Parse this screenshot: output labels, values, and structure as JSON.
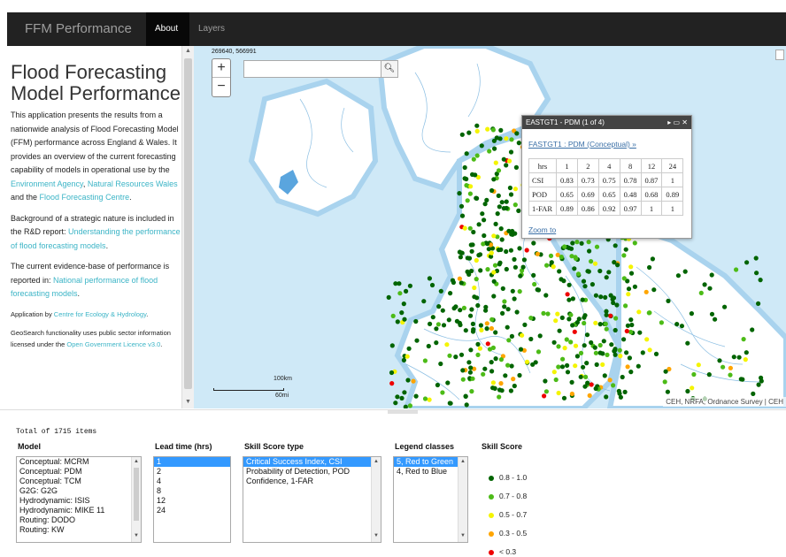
{
  "navbar": {
    "brand": "FFM Performance",
    "tabs": [
      {
        "label": "About",
        "active": true
      },
      {
        "label": "Layers",
        "active": false
      }
    ],
    "background": "#222222"
  },
  "sidebar": {
    "title": "Flood Forecasting Model Performance",
    "p1": {
      "text_a": "This application presents the results from a nationwide analysis of Flood Forecasting Model (FFM) performance across England & Wales. It provides an overview of the current forecasting capability of models in operational use by the ",
      "link_a": "Environment Agency",
      "text_b": ", ",
      "link_b": "Natural Resources Wales",
      "text_c": " and the ",
      "link_c": "Flood Forecasting Centre",
      "text_d": "."
    },
    "p2": {
      "text_a": "Background of a strategic nature is included in the R&D report: ",
      "link_a": "Understanding the performance of flood forecasting models",
      "text_b": "."
    },
    "p3": {
      "text_a": "The current evidence-base of performance is reported in: ",
      "link_a": "National performance of flood forecasting models",
      "text_b": "."
    },
    "p4": {
      "text_a": "Application by ",
      "link_a": "Centre for Ecology & Hydrology",
      "text_b": "."
    },
    "p5": {
      "text_a": "GeoSearch functionality uses public sector information licensed under the ",
      "link_a": "Open Government Licence v3.0",
      "text_b": "."
    },
    "link_color": "#3bb4c6"
  },
  "map": {
    "coords": "269640, 566991",
    "zoom_in": "+",
    "zoom_out": "−",
    "search_placeholder": "",
    "search_icon": "search-icon",
    "scale_km": "100km",
    "scale_mi": "60mi",
    "attribution": "CEH, NRFA, Ordnance Survey | CEH",
    "sea_color": "#cfe9f7",
    "land_color": "#ffffff",
    "river_color": "#7fb8e0"
  },
  "popup": {
    "header": "EASTGT1 - PDM (1 of 4)",
    "controls": "▸ ▭ ✕",
    "link": "FASTGT1 : PDM (Conceptual) »",
    "table": {
      "headers": [
        "hrs",
        "1",
        "2",
        "4",
        "8",
        "12",
        "24"
      ],
      "rows": [
        [
          "CSI",
          "0.83",
          "0.73",
          "0.75",
          "0.78",
          "0.87",
          "1"
        ],
        [
          "POD",
          "0.65",
          "0.69",
          "0.65",
          "0.48",
          "0.68",
          "0.89"
        ],
        [
          "1-FAR",
          "0.89",
          "0.86",
          "0.92",
          "0.97",
          "1",
          "1"
        ]
      ]
    },
    "zoom_link": "Zoom to"
  },
  "bottom": {
    "total": "Total of 1715 items",
    "model": {
      "label": "Model",
      "options": [
        "Conceptual: MCRM",
        "Conceptual: PDM",
        "Conceptual: TCM",
        "G2G: G2G",
        "Hydrodynamic: ISIS",
        "Hydrodynamic: MIKE 11",
        "Routing: DODO",
        "Routing: KW"
      ]
    },
    "lead_time": {
      "label": "Lead time (hrs)",
      "options": [
        "1",
        "2",
        "4",
        "8",
        "12",
        "24"
      ],
      "selected": "1"
    },
    "skill_type": {
      "label": "Skill Score type",
      "options": [
        "Critical Success Index, CSI",
        "Probability of Detection, POD",
        "Confidence, 1-FAR"
      ],
      "selected": "Critical Success Index, CSI"
    },
    "legend_classes": {
      "label": "Legend classes",
      "options": [
        "5, Red to Green",
        "4, Red to Blue"
      ],
      "selected": "5, Red to Green"
    },
    "skill_score": {
      "label": "Skill Score",
      "items": [
        {
          "label": "0.8 - 1.0",
          "color": "#006400"
        },
        {
          "label": "0.7 - 0.8",
          "color": "#4cbb17"
        },
        {
          "label": "0.5 - 0.7",
          "color": "#f4f400"
        },
        {
          "label": "0.3 - 0.5",
          "color": "#ffa500"
        },
        {
          "label": "< 0.3",
          "color": "#ee0000"
        }
      ]
    }
  }
}
